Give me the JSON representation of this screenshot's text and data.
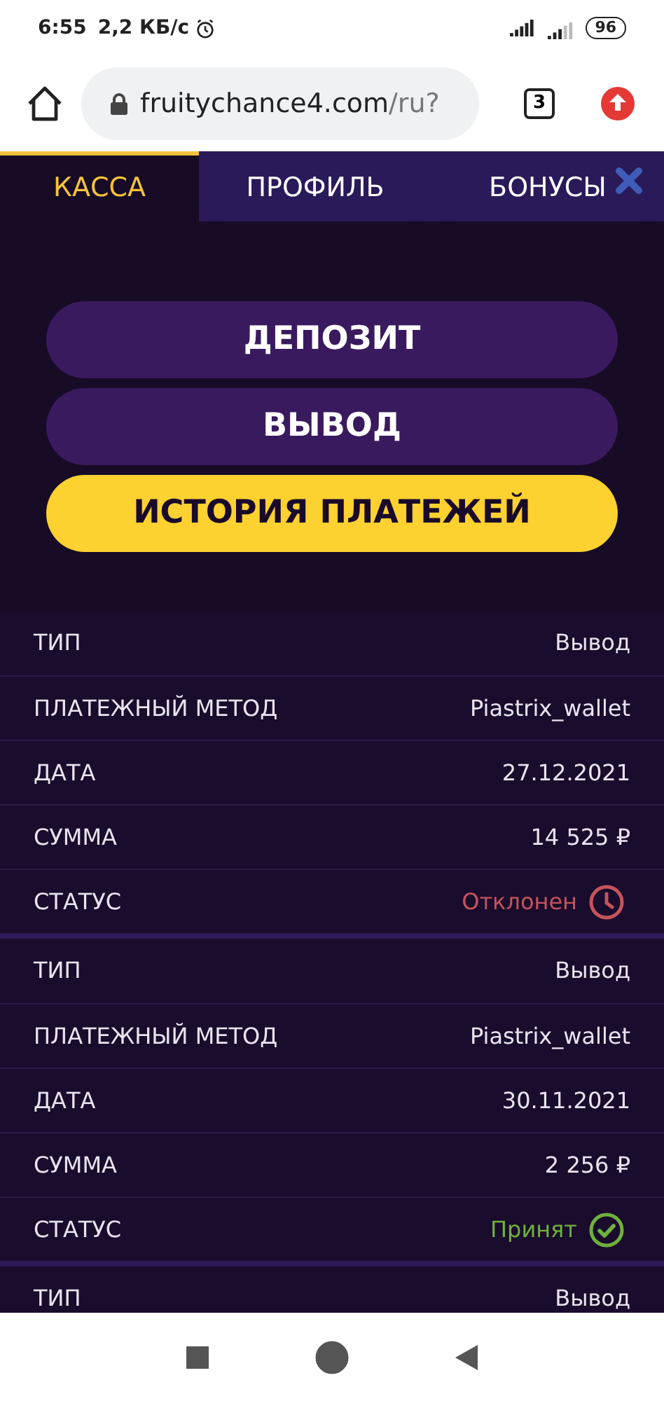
{
  "status_bar": {
    "time": "6:55",
    "speed": "2,2 КБ/с",
    "battery": "96"
  },
  "browser": {
    "url_host": "fruitychance4.com",
    "url_path": "/ru?",
    "tab_count": "3"
  },
  "tabs": [
    {
      "label": "КАССА",
      "selected": true
    },
    {
      "label": "ПРОФИЛЬ",
      "selected": false
    },
    {
      "label": "БОНУСЫ",
      "selected": false
    }
  ],
  "buttons": [
    {
      "label": "ДЕПОЗИТ",
      "selected": false
    },
    {
      "label": "ВЫВОД",
      "selected": false
    },
    {
      "label": "ИСТОРИЯ ПЛАТЕЖЕЙ",
      "selected": true
    }
  ],
  "records": [
    {
      "rows": [
        {
          "label": "ТИП",
          "value": "Вывод"
        },
        {
          "label": "ПЛАТЕЖНЫЙ МЕТОД",
          "value": "Piastrix_wallet"
        },
        {
          "label": "ДАТА",
          "value": "27.12.2021"
        },
        {
          "label": "СУММА",
          "value": "14 525 ₽"
        },
        {
          "label": "СТАТУС",
          "value": "Отклонен",
          "kind": "rejected"
        }
      ]
    },
    {
      "rows": [
        {
          "label": "ТИП",
          "value": "Вывод"
        },
        {
          "label": "ПЛАТЕЖНЫЙ МЕТОД",
          "value": "Piastrix_wallet"
        },
        {
          "label": "ДАТА",
          "value": "30.11.2021"
        },
        {
          "label": "СУММА",
          "value": "2 256 ₽"
        },
        {
          "label": "СТАТУС",
          "value": "Принят",
          "kind": "accepted"
        }
      ]
    },
    {
      "rows": [
        {
          "label": "ТИП",
          "value": "Вывод"
        }
      ]
    }
  ]
}
